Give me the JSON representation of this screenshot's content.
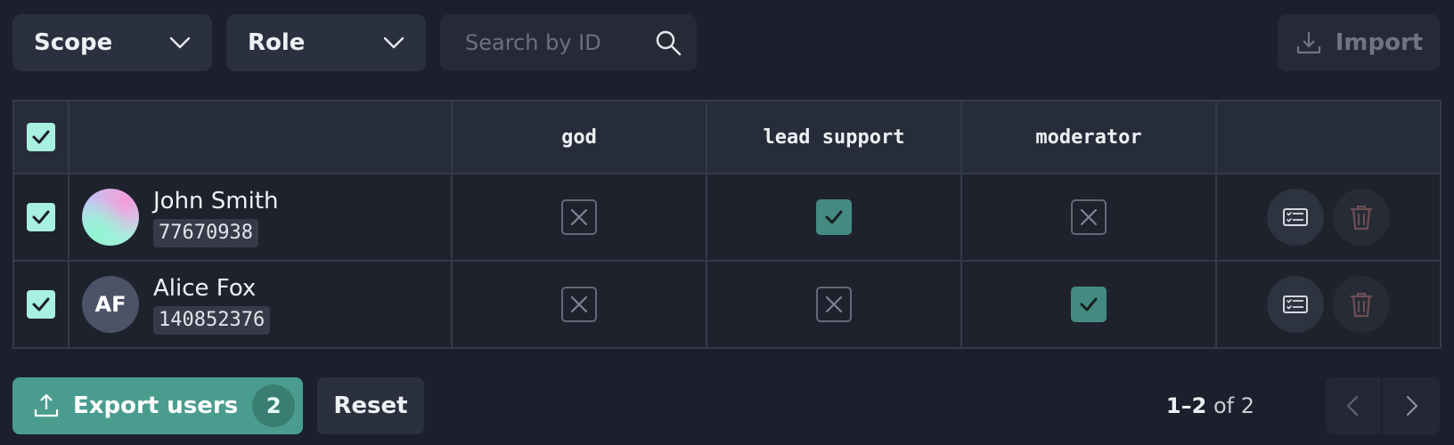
{
  "toolbar": {
    "scope_label": "Scope",
    "role_label": "Role",
    "search_placeholder": "Search by ID",
    "search_value": "",
    "import_label": "Import"
  },
  "table": {
    "columns": [
      "",
      "",
      "god",
      "lead support",
      "moderator",
      ""
    ],
    "select_all": true,
    "rows": [
      {
        "selected": true,
        "name": "John Smith",
        "id": "77670938",
        "avatar": "gradient",
        "initials": "",
        "permissions": {
          "god": false,
          "lead support": true,
          "moderator": false
        }
      },
      {
        "selected": true,
        "name": "Alice Fox",
        "id": "140852376",
        "avatar": "initials",
        "initials": "AF",
        "permissions": {
          "god": false,
          "lead support": false,
          "moderator": true
        }
      }
    ]
  },
  "footer": {
    "export_label": "Export users",
    "export_count": "2",
    "reset_label": "Reset",
    "range": "1–2",
    "of_text": "of",
    "total": "2"
  },
  "icons": {
    "dropdown": "chevron-down-icon",
    "search": "search-icon",
    "import": "download-icon",
    "export": "upload-icon",
    "edit": "list-card-icon",
    "delete": "trash-icon",
    "prev": "chevron-left-icon",
    "next": "chevron-right-icon"
  },
  "colors": {
    "background": "#1c202c",
    "accent": "#4a9d8e",
    "checkbox": "#a8f0df",
    "granted": "#448a83",
    "delete_icon": "#6e4e55"
  }
}
